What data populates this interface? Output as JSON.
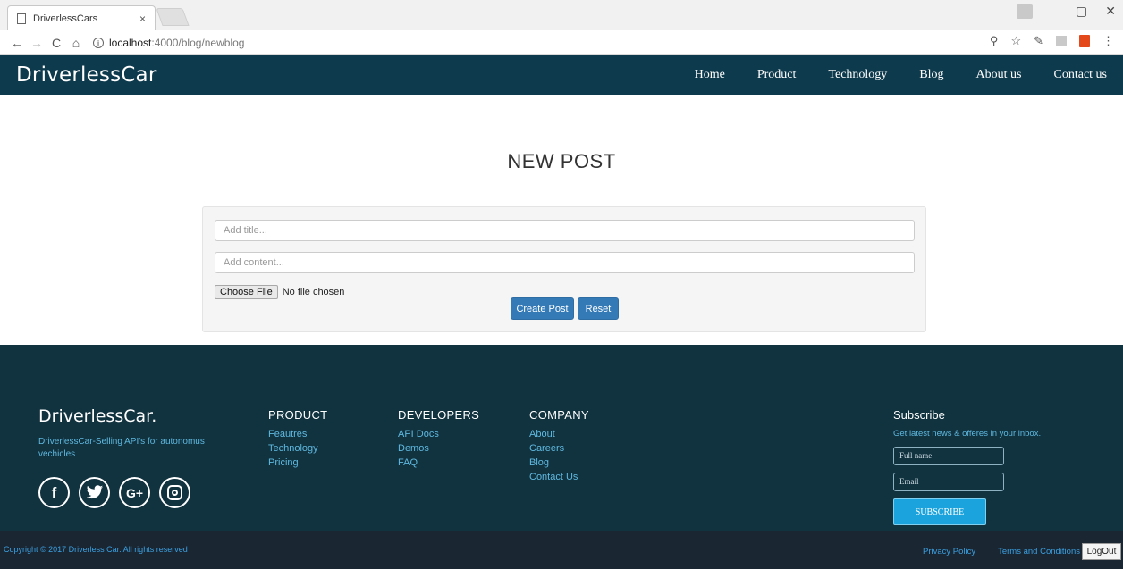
{
  "browser": {
    "tab_title": "DriverlessCars",
    "tab_close": "×",
    "url_host": "localhost",
    "url_path": ":4000/blog/newblog",
    "back": "←",
    "forward": "→",
    "reload": "C",
    "home": "⌂",
    "window_min": "–",
    "window_max": "▢",
    "window_close": "✕",
    "menu": "⋮",
    "zoom_icon": "⚲",
    "star_icon": "☆",
    "pen_icon": "✎"
  },
  "nav": {
    "brand": "DriverlessCar",
    "links": [
      "Home",
      "Product",
      "Technology",
      "Blog",
      "About us",
      "Contact us"
    ]
  },
  "main": {
    "title": "NEW POST",
    "title_placeholder": "Add title...",
    "content_placeholder": "Add content...",
    "choose_file": "Choose File",
    "no_file": "No file chosen",
    "create_button": "Create Post",
    "reset_button": "Reset"
  },
  "footer": {
    "brand": "DriverlessCar.",
    "tagline": "DriverlessCar-Selling API's for autonomus vechicles",
    "socials": [
      "f",
      "",
      "G+",
      ""
    ],
    "product": {
      "heading": "PRODUCT",
      "links": [
        "Feautres",
        "Technology",
        "Pricing"
      ]
    },
    "developers": {
      "heading": "DEVELOPERS",
      "links": [
        "API Docs",
        "Demos",
        "FAQ"
      ]
    },
    "company": {
      "heading": "COMPANY",
      "links": [
        "About",
        "Careers",
        "Blog",
        "Contact Us"
      ]
    },
    "subscribe": {
      "heading": "Subscribe",
      "text": "Get latest news & offeres in your inbox.",
      "name_placeholder": "Full name",
      "email_placeholder": "Email",
      "button": "SUBSCRIBE"
    },
    "copyright": "Copyright © 2017 Driverless Car. All rights reserved",
    "privacy": "Privacy Policy",
    "terms": "Terms and Conditions",
    "logout": "LogOut"
  },
  "colors": {
    "nav_bg": "#0e3a4d",
    "footer_bg": "#11323f",
    "bottom_bar_bg": "#1b2633",
    "primary_button": "#337ab7",
    "subscribe_button": "#1aa3dc",
    "link_accent": "#5fb9e0"
  }
}
